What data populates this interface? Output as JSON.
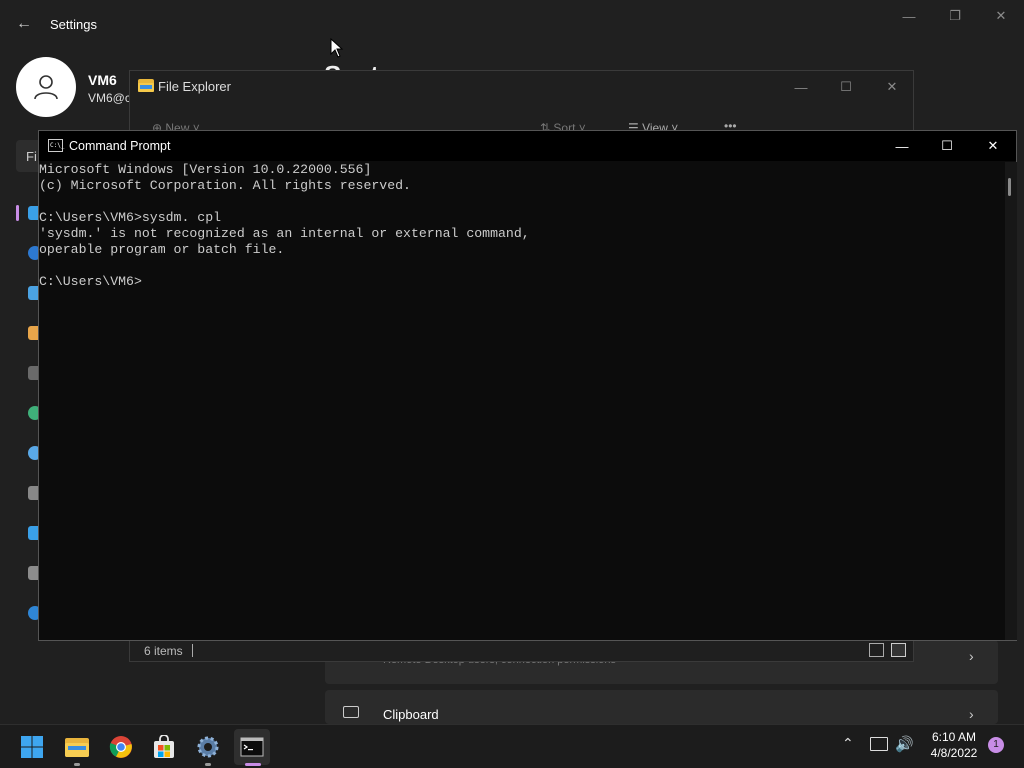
{
  "settings": {
    "title": "Settings",
    "user": {
      "name": "VM6",
      "email": "VM6@c"
    },
    "search_stub": "Fi",
    "section_title_fragment": "Syst",
    "cards": {
      "remote_desktop_desc": "Remote Desktop users, connection permissions",
      "clipboard_label": "Clipboard"
    }
  },
  "explorer": {
    "title": "File Explorer",
    "toolbar": {
      "new_label": "New",
      "sort_label": "Sort",
      "view_label": "View",
      "more_label": "•••"
    },
    "status": {
      "items": "6 items"
    }
  },
  "cmd": {
    "title": "Command Prompt",
    "icon_text": "C:\\_",
    "lines": [
      "Microsoft Windows [Version 10.0.22000.556]",
      "(c) Microsoft Corporation. All rights reserved.",
      "",
      "C:\\Users\\VM6>sysdm. cpl",
      "'sysdm.' is not recognized as an internal or external command,",
      "operable program or batch file.",
      "",
      "C:\\Users\\VM6>"
    ]
  },
  "taskbar": {
    "apps": [
      {
        "name": "start-icon"
      },
      {
        "name": "file-explorer-icon"
      },
      {
        "name": "chrome-icon"
      },
      {
        "name": "store-icon"
      },
      {
        "name": "settings-icon"
      },
      {
        "name": "command-prompt-icon"
      }
    ],
    "time": "6:10 AM",
    "date": "4/8/2022",
    "notification_count": "1"
  },
  "colors": {
    "cmd_bg": "#0c0c0c",
    "cmd_text": "#cccccc",
    "accent": "#c88de6",
    "taskbar_bg": "#1c1c1c"
  }
}
